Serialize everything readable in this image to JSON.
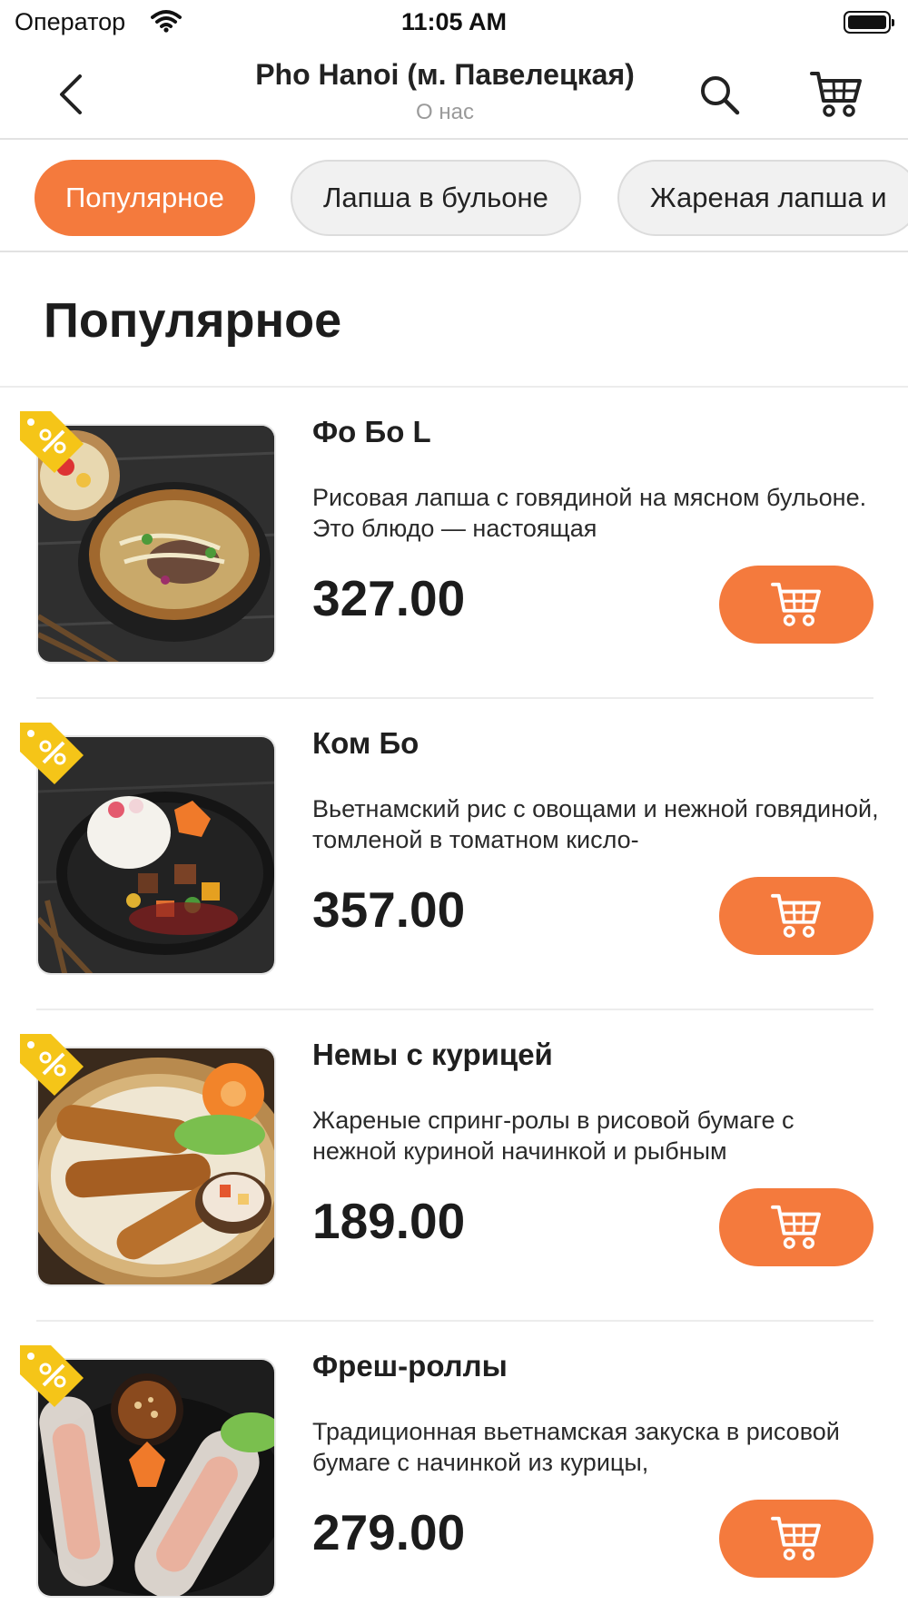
{
  "status_bar": {
    "carrier": "Оператор",
    "time": "11:05 AM"
  },
  "nav": {
    "title": "Pho Hanoi (м. Павелецкая)",
    "subtitle": "О нас",
    "back_icon": "chevron-left-icon",
    "search_icon": "search-icon",
    "cart_icon": "cart-icon"
  },
  "categories": [
    {
      "label": "Популярное",
      "active": true
    },
    {
      "label": "Лапша в бульоне",
      "active": false
    },
    {
      "label": "Жареная лапша и",
      "active": false
    }
  ],
  "section": {
    "title": "Популярное"
  },
  "products": [
    {
      "name": "Фо Бо L",
      "description": "Рисовая лапша с говядиной на мясном бульоне. Это блюдо — настоящая",
      "price": "327.00",
      "badge_icon": "discount-tag-icon"
    },
    {
      "name": "Ком Бо",
      "description": "Вьетнамский рис с овощами и нежной говядиной, томленой в томатном кисло-",
      "price": "357.00",
      "badge_icon": "discount-tag-icon"
    },
    {
      "name": "Немы с курицей",
      "description": "Жареные спринг-ролы в рисовой бумаге с нежной куриной начинкой и рыбным",
      "price": "189.00",
      "badge_icon": "discount-tag-icon"
    },
    {
      "name": "Фреш-роллы",
      "description": "Традиционная вьетнамская закуска в рисовой бумаге с начинкой из курицы,",
      "price": "279.00",
      "badge_icon": "discount-tag-icon"
    }
  ],
  "colors": {
    "accent": "#f47a3d",
    "badge": "#f5c518",
    "divider": "#ececec"
  }
}
